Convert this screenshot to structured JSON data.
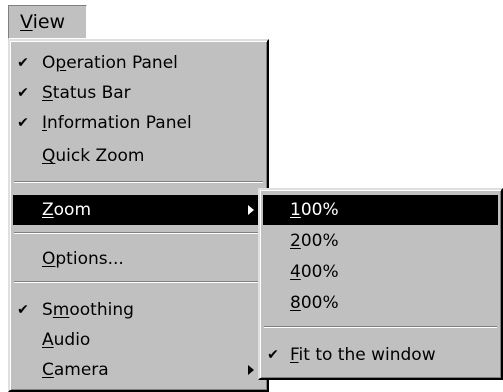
{
  "menubar": {
    "view": {
      "pre": "",
      "accel": "V",
      "post": "iew"
    }
  },
  "view_menu": {
    "items": [
      {
        "checked": true,
        "pre": "O",
        "accel": "p",
        "post": "eration Panel"
      },
      {
        "checked": true,
        "pre": "",
        "accel": "S",
        "post": "tatus Bar"
      },
      {
        "checked": true,
        "pre": "",
        "accel": "I",
        "post": "nformation Panel"
      },
      {
        "checked": false,
        "pre": "",
        "accel": "Q",
        "post": "uick Zoom"
      },
      {
        "checked": false,
        "pre": "",
        "accel": "Z",
        "post": "oom",
        "selected": true,
        "submenu": true
      },
      {
        "checked": false,
        "pre": "",
        "accel": "O",
        "post": "ptions..."
      },
      {
        "checked": true,
        "pre": "S",
        "accel": "m",
        "post": "oothing"
      },
      {
        "checked": false,
        "pre": "",
        "accel": "A",
        "post": "udio"
      },
      {
        "checked": false,
        "pre": "",
        "accel": "C",
        "post": "amera",
        "submenu": true
      }
    ]
  },
  "zoom_menu": {
    "items": [
      {
        "checked": false,
        "pre": "",
        "accel": "1",
        "post": "00%",
        "selected": true
      },
      {
        "checked": false,
        "pre": "",
        "accel": "2",
        "post": "00%"
      },
      {
        "checked": false,
        "pre": "",
        "accel": "4",
        "post": "00%"
      },
      {
        "checked": false,
        "pre": "",
        "accel": "8",
        "post": "00%"
      },
      {
        "checked": true,
        "pre": "",
        "accel": "F",
        "post": "it to the window"
      }
    ]
  },
  "check_glyph": "✔"
}
